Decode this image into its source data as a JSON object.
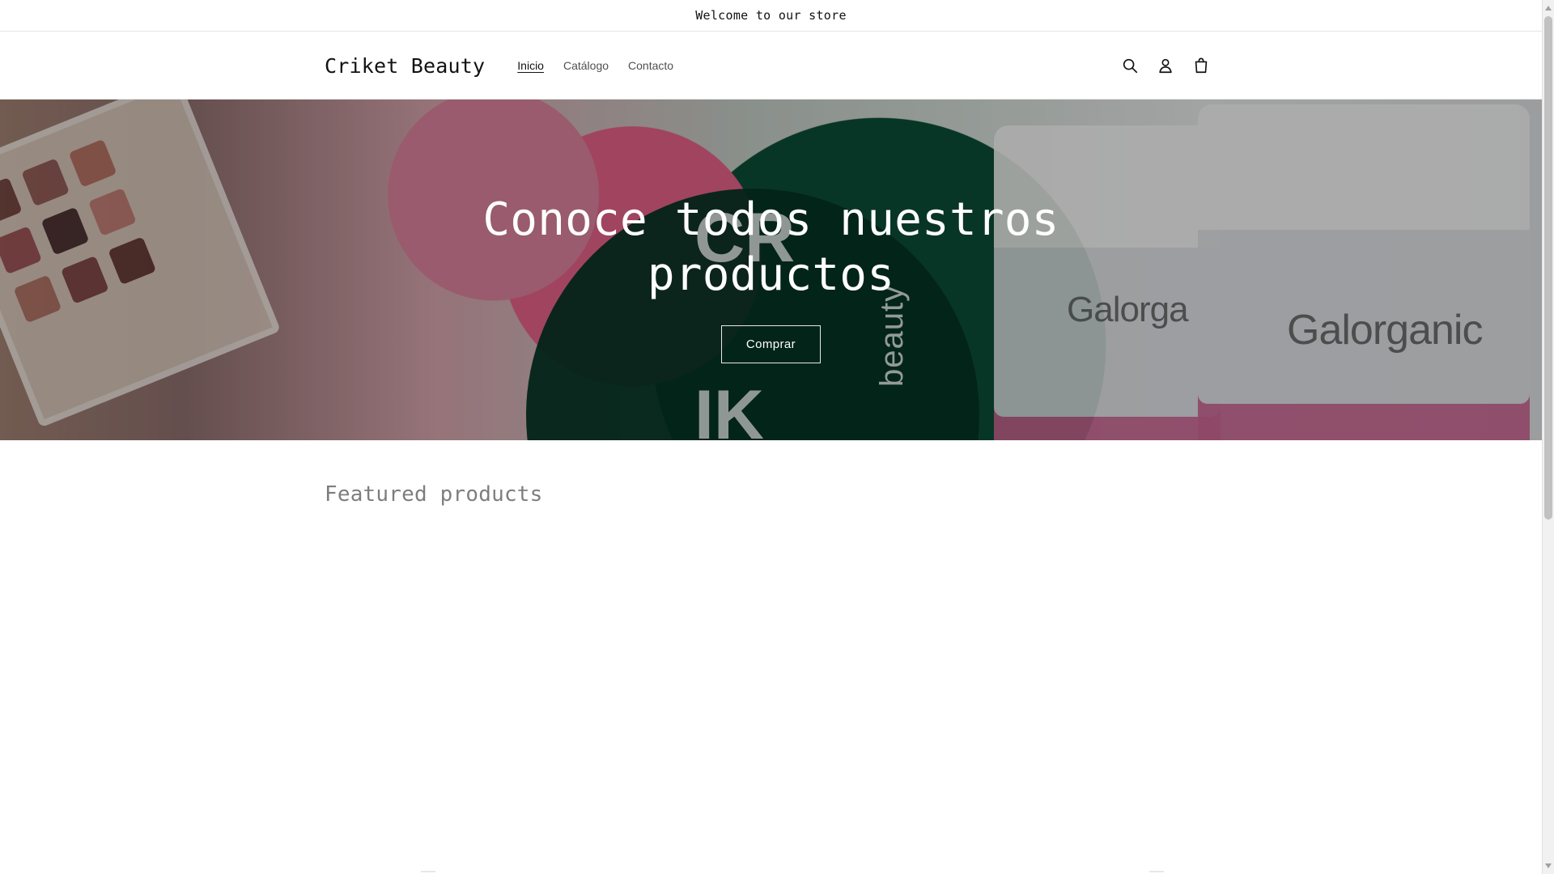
{
  "announcement": {
    "text": "Welcome to our store"
  },
  "header": {
    "brand": "Criket Beauty",
    "nav": [
      {
        "label": "Inicio",
        "active": true
      },
      {
        "label": "Catálogo",
        "active": false
      },
      {
        "label": "Contacto",
        "active": false
      }
    ],
    "icons": [
      "search-icon",
      "account-icon",
      "cart-icon"
    ]
  },
  "hero": {
    "title_line_1": "Conoce todos nuestros",
    "title_line_2": "productos",
    "button_label": "Comprar",
    "image_text": {
      "logo_top": "CR",
      "logo_bottom": "IK",
      "logo_side": "beauty",
      "jar_1": "Galorga",
      "jar_2": "Galorganic"
    }
  },
  "featured": {
    "title": "Featured products"
  },
  "colors": {
    "text": "#121212",
    "border": "#e5e5e5",
    "hero_overlay": "rgba(0,0,0,0.28)",
    "white": "#ffffff"
  }
}
